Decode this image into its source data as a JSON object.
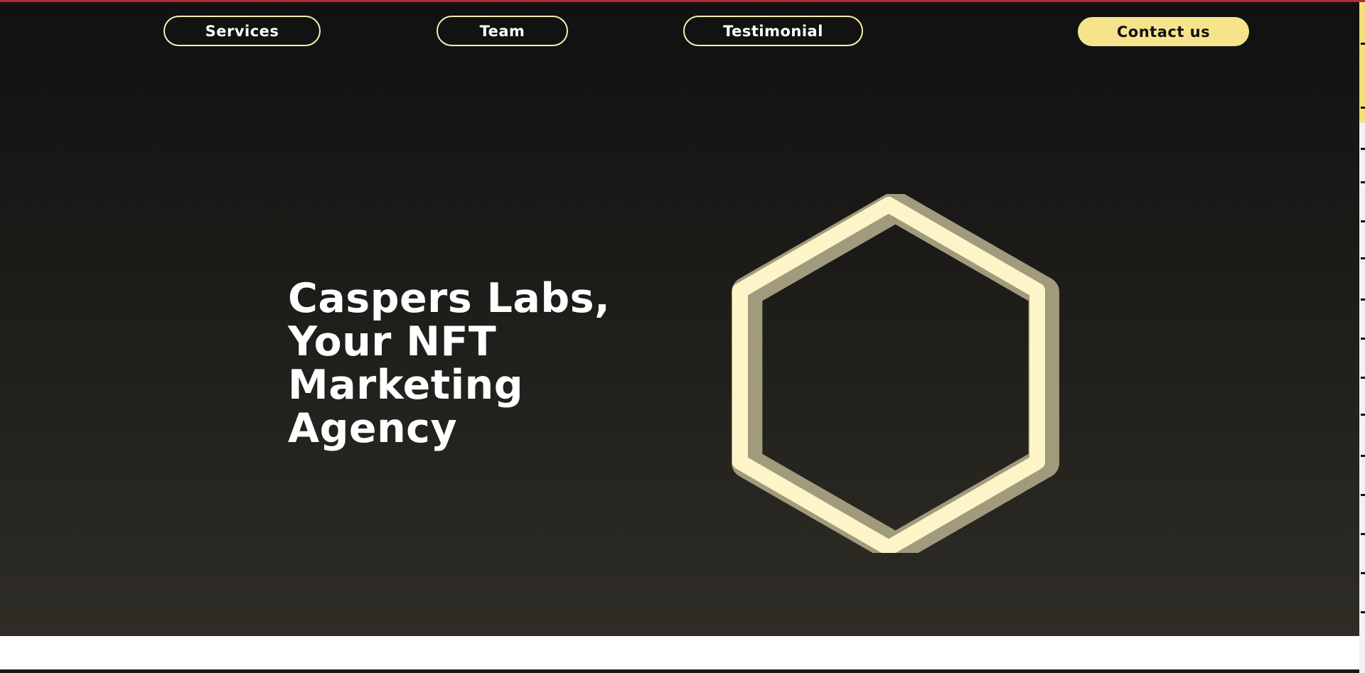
{
  "nav": {
    "services_label": "Services",
    "team_label": "Team",
    "testimonial_label": "Testimonial",
    "contact_label": "Contact us"
  },
  "hero": {
    "headline_lines": [
      "Caspers Labs,",
      "Your NFT",
      "Marketing",
      "Agency"
    ]
  },
  "graphic": {
    "name": "hexagon-ring",
    "ring_color": "#fdf4c7",
    "shadow_color": "#a19b7d"
  },
  "colors": {
    "accent": "#f5e48c",
    "outline": "#f6eeb4",
    "top_bar": "#b02a30"
  }
}
